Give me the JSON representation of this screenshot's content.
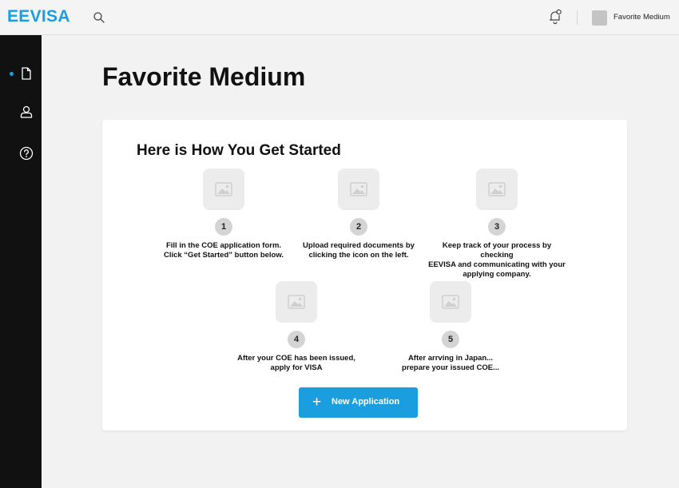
{
  "header": {
    "logo": "EEVISA",
    "user_name": "Favorite Medium"
  },
  "icons": {
    "search": "search-icon",
    "notifications": "bell-icon",
    "nav": [
      "document-icon",
      "user-icon",
      "help-icon"
    ]
  },
  "page": {
    "title": "Favorite Medium"
  },
  "card": {
    "heading": "Here is How You Get Started",
    "steps": [
      {
        "number": "1",
        "text": "Fill in the COE application form.\nClick “Get Started” button below."
      },
      {
        "number": "2",
        "text": "Upload required documents by\nclicking the icon on the left."
      },
      {
        "number": "3",
        "text": "Keep track of your process by checking\nEEVISA and communicating with your\napplying company."
      },
      {
        "number": "4",
        "text": "After your COE has been issued,\napply for VISA"
      },
      {
        "number": "5",
        "text": "After arrving in Japan...\nprepare your issued COE..."
      }
    ],
    "button_label": "New Application",
    "button_icon": "+"
  },
  "colors": {
    "accent": "#1a9ee0",
    "sidebar": "#111111",
    "background": "#f2f2f2"
  }
}
